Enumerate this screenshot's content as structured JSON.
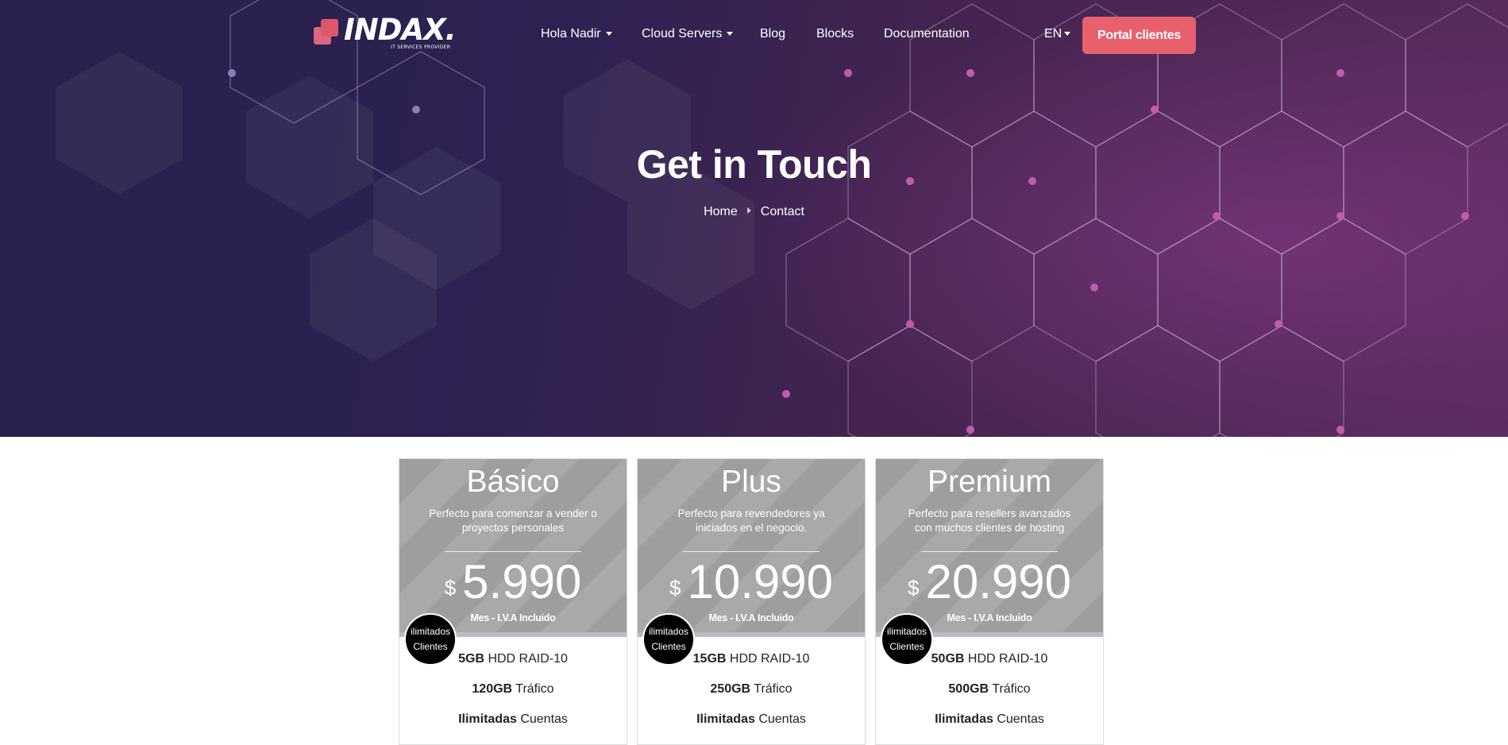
{
  "brand": {
    "name": "INDAX.",
    "tagline": "IT SERVICES PROVIDER"
  },
  "nav": {
    "items": [
      {
        "label": "Hola Nadir",
        "dropdown": true
      },
      {
        "label": "Cloud Servers",
        "dropdown": true
      },
      {
        "label": "Blog",
        "dropdown": false
      },
      {
        "label": "Blocks",
        "dropdown": false
      },
      {
        "label": "Documentation",
        "dropdown": false
      }
    ],
    "language": "EN",
    "cta_label": "Portal clientes"
  },
  "hero": {
    "title": "Get in Touch",
    "breadcrumb": [
      "Home",
      "Contact"
    ]
  },
  "colors": {
    "accent": "#e8606e",
    "hero_dark": "#26214d",
    "hero_light": "#5a2a5f",
    "card_header": "#a3a3a3"
  },
  "plans": [
    {
      "name": "Básico",
      "description": "Perfecto para comenzar a vender o proyectos personales",
      "currency": "$",
      "price": "5.990",
      "price_note": "Mes - I.V.A Incluido",
      "badge": [
        "ilimitados",
        "Clientes"
      ],
      "features": [
        {
          "strong": "5GB",
          "text": "HDD RAID-10"
        },
        {
          "strong": "120GB",
          "text": "Tráfico"
        },
        {
          "strong": "Ilimitadas",
          "text": "Cuentas"
        }
      ]
    },
    {
      "name": "Plus",
      "description": "Perfecto para revendedores ya iniciados en el negocio.",
      "currency": "$",
      "price": "10.990",
      "price_note": "Mes - I.V.A Incluido",
      "badge": [
        "ilimitados",
        "Clientes"
      ],
      "features": [
        {
          "strong": "15GB",
          "text": "HDD RAID-10"
        },
        {
          "strong": "250GB",
          "text": "Tráfico"
        },
        {
          "strong": "Ilimitadas",
          "text": "Cuentas"
        }
      ]
    },
    {
      "name": "Premium",
      "description": "Perfecto para resellers avanzados con muchos clientes de hosting",
      "currency": "$",
      "price": "20.990",
      "price_note": "Mes - I.V.A Incluido",
      "badge": [
        "ilimitados",
        "Clientes"
      ],
      "features": [
        {
          "strong": "50GB",
          "text": "HDD RAID-10"
        },
        {
          "strong": "500GB",
          "text": "Tráfico"
        },
        {
          "strong": "Ilimitadas",
          "text": "Cuentas"
        }
      ]
    }
  ]
}
